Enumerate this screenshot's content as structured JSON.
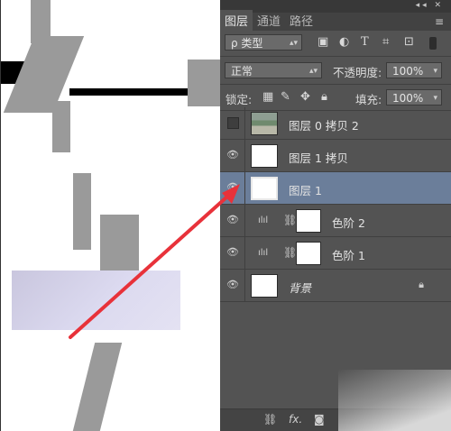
{
  "panel": {
    "top_controls": "◂◂ ✕",
    "tabs": [
      {
        "label": "图层",
        "active": true
      },
      {
        "label": "通道",
        "active": false
      },
      {
        "label": "路径",
        "active": false
      }
    ],
    "menu_icon": "≡",
    "filter": {
      "label": "ρ 类型",
      "icons": [
        "image-filter-icon",
        "adjustment-filter-icon",
        "text-filter-icon",
        "shape-filter-icon",
        "smart-object-filter-icon"
      ]
    },
    "blend_mode": "正常",
    "opacity_label": "不透明度:",
    "opacity_value": "100%",
    "lock_label": "锁定:",
    "fill_label": "填充:",
    "fill_value": "100%",
    "layers": [
      {
        "name": "图层 0 拷贝 2",
        "visible": false,
        "selected": false,
        "type": "photo"
      },
      {
        "name": "图层 1 拷贝",
        "visible": true,
        "selected": false,
        "type": "pixel"
      },
      {
        "name": "图层 1",
        "visible": true,
        "selected": true,
        "type": "pixel"
      },
      {
        "name": "色阶 2",
        "visible": true,
        "selected": false,
        "type": "adjustment"
      },
      {
        "name": "色阶 1",
        "visible": true,
        "selected": false,
        "type": "adjustment"
      },
      {
        "name": "背景",
        "visible": true,
        "selected": false,
        "type": "background",
        "locked": true
      }
    ],
    "bottom_icons": [
      "link-icon",
      "fx-icon",
      "mask-icon"
    ],
    "bottom_fx": "fx."
  },
  "colors": {
    "panel_bg": "#535353",
    "selected_row": "#6b7e9a",
    "arrow": "#e8323a"
  }
}
